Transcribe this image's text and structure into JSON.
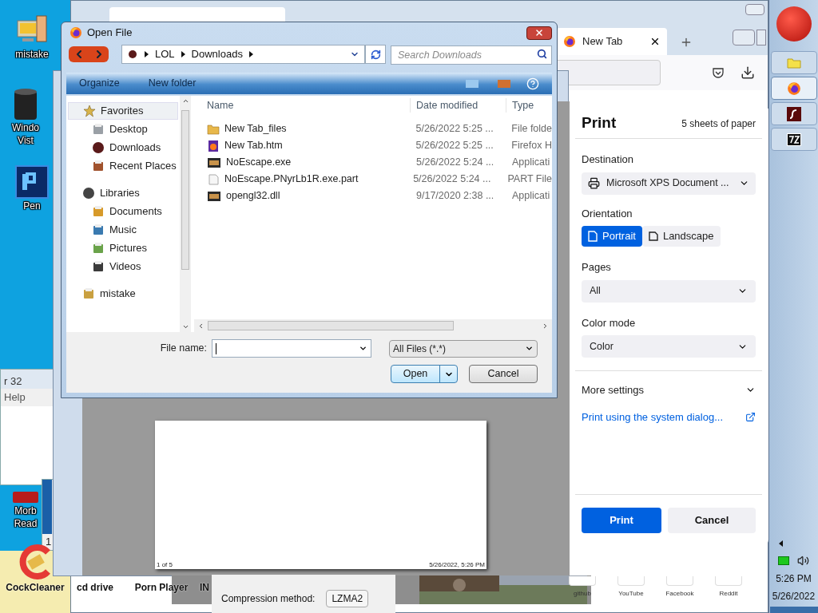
{
  "desktop_icons": [
    {
      "kind": "computer",
      "lines": [
        "mistake"
      ]
    },
    {
      "kind": "bin",
      "lines": [
        "Windo",
        "Vist"
      ]
    },
    {
      "kind": "ps",
      "lines": [
        "Pen"
      ]
    },
    {
      "kind": "reader",
      "lines": [
        "Morb",
        "Read"
      ]
    },
    {
      "kind": "cleaner",
      "lines": [
        "CockCleaner"
      ]
    },
    {
      "kind": "drive",
      "lines": [
        "cd drive"
      ]
    },
    {
      "kind": "player",
      "lines": [
        "Porn Player"
      ]
    },
    {
      "kind": "tile",
      "lines": [
        "IN"
      ]
    }
  ],
  "back_window": {
    "title": "r 32",
    "menu": "Help",
    "status": "1"
  },
  "archive_window": {
    "label": "Compression method:",
    "value": "LZMA2"
  },
  "browser": {
    "tab": "New Tab",
    "shortcuts": [
      "github",
      "YouTube",
      "Facebook",
      "Reddit"
    ],
    "preview": {
      "footer_left": "1 of 5",
      "footer_right": "5/26/2022, 5:26 PM"
    },
    "print_panel": {
      "title": "Print",
      "sheets": "5 sheets of paper",
      "destination": {
        "label": "Destination",
        "value": "Microsoft XPS Document ..."
      },
      "orientation": {
        "label": "Orientation",
        "options": [
          {
            "label": "Portrait",
            "selected": true
          },
          {
            "label": "Landscape",
            "selected": false
          }
        ]
      },
      "pages": {
        "label": "Pages",
        "value": "All"
      },
      "color_mode": {
        "label": "Color mode",
        "value": "Color"
      },
      "more_settings": "More settings",
      "system_dialog_link": "Print using the system dialog...",
      "buttons": {
        "print": "Print",
        "cancel": "Cancel"
      }
    }
  },
  "open_file_dialog": {
    "title": "Open File",
    "breadcrumb": [
      "LOL",
      "Downloads"
    ],
    "search_placeholder": "Search Downloads",
    "toolbar": [
      "Organize",
      "New folder"
    ],
    "nav": [
      {
        "label": "Favorites",
        "kind": "star",
        "selected": true,
        "children": [
          {
            "label": "Desktop",
            "kind": "desktop",
            "selected": false
          },
          {
            "label": "Downloads",
            "kind": "downloads",
            "selected": false
          },
          {
            "label": "Recent Places",
            "kind": "recent",
            "selected": false
          }
        ]
      },
      {
        "label": "Libraries",
        "kind": "libraries",
        "selected": false,
        "children": [
          {
            "label": "Documents",
            "kind": "documents",
            "selected": false
          },
          {
            "label": "Music",
            "kind": "music",
            "selected": false
          },
          {
            "label": "Pictures",
            "kind": "pictures",
            "selected": false
          },
          {
            "label": "Videos",
            "kind": "videos",
            "selected": false
          }
        ]
      },
      {
        "label": "mistake",
        "kind": "user",
        "selected": false
      }
    ],
    "columns": [
      "Name",
      "Date modified",
      "Type"
    ],
    "rows": [
      {
        "kind": "folder",
        "name": "New Tab_files",
        "date": "5/26/2022 5:25 ...",
        "type": "File folde"
      },
      {
        "kind": "htm",
        "name": "New Tab.htm",
        "date": "5/26/2022 5:25 ...",
        "type": "Firefox H"
      },
      {
        "kind": "exe",
        "name": "NoEscape.exe",
        "date": "5/26/2022 5:24 ...",
        "type": "Applicati"
      },
      {
        "kind": "part",
        "name": "NoEscape.PNyrLb1R.exe.part",
        "date": "5/26/2022 5:24 ...",
        "type": "PART File"
      },
      {
        "kind": "exe",
        "name": "opengl32.dll",
        "date": "9/17/2020 2:38 ...",
        "type": "Applicati"
      }
    ],
    "file_name_label": "File name:",
    "filter": "All Files (*.*)",
    "buttons": {
      "open": "Open",
      "cancel": "Cancel"
    }
  },
  "taskbar": {
    "time": "5:26 PM",
    "date": "5/26/2022",
    "buttons": [
      {
        "kind": "folder",
        "selected": false
      },
      {
        "kind": "firefox",
        "selected": true
      },
      {
        "kind": "flash",
        "selected": false
      },
      {
        "kind": "archive",
        "selected": false
      }
    ]
  }
}
